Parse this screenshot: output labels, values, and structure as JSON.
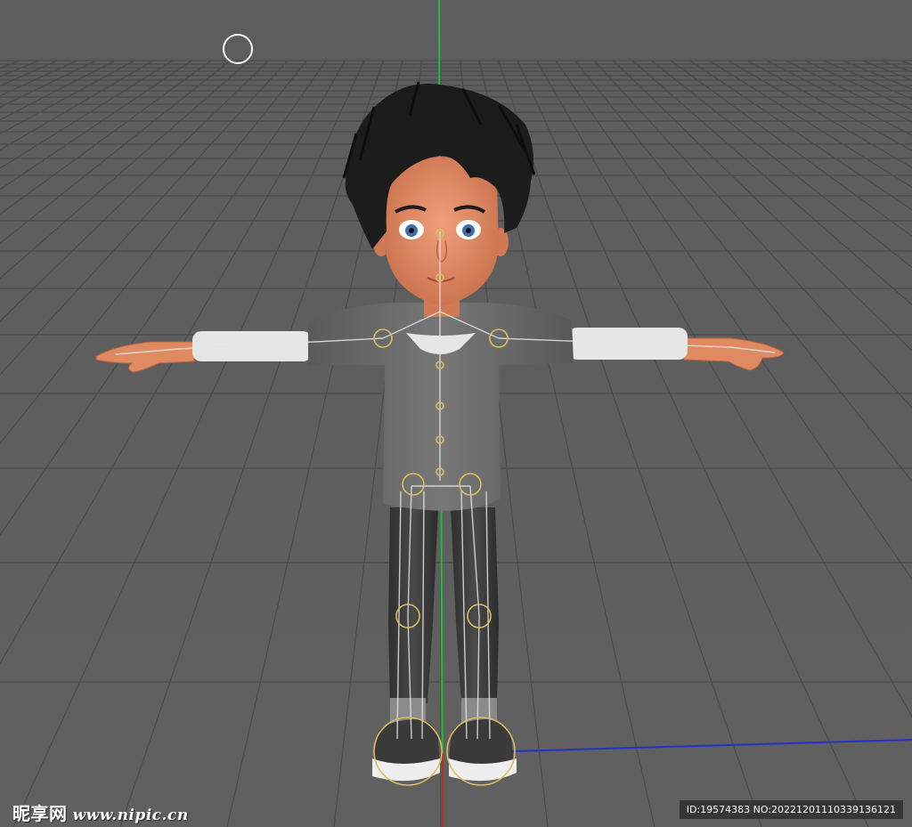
{
  "viewport": {
    "background": "#5f5f5f",
    "grid_color": "#4a4a4a",
    "axis_colors": {
      "y": "#1fbf3a",
      "z": "#2430c8",
      "x": "#c22a2a"
    }
  },
  "character": {
    "skin": "#e08a62",
    "hair": "#1c1c1c",
    "shirt": "#6a6a6a",
    "undershirt": "#e6e6e6",
    "pants": "#3a3a3a",
    "shoes": "#e8e8e8",
    "rig_joint_color": "#d9c060",
    "eyes": "#3e6fb0"
  },
  "watermark": {
    "brand": "昵享网",
    "site": "www.nipic.cn",
    "id_text": "ID:19574383 NO:20221201110339136121"
  }
}
